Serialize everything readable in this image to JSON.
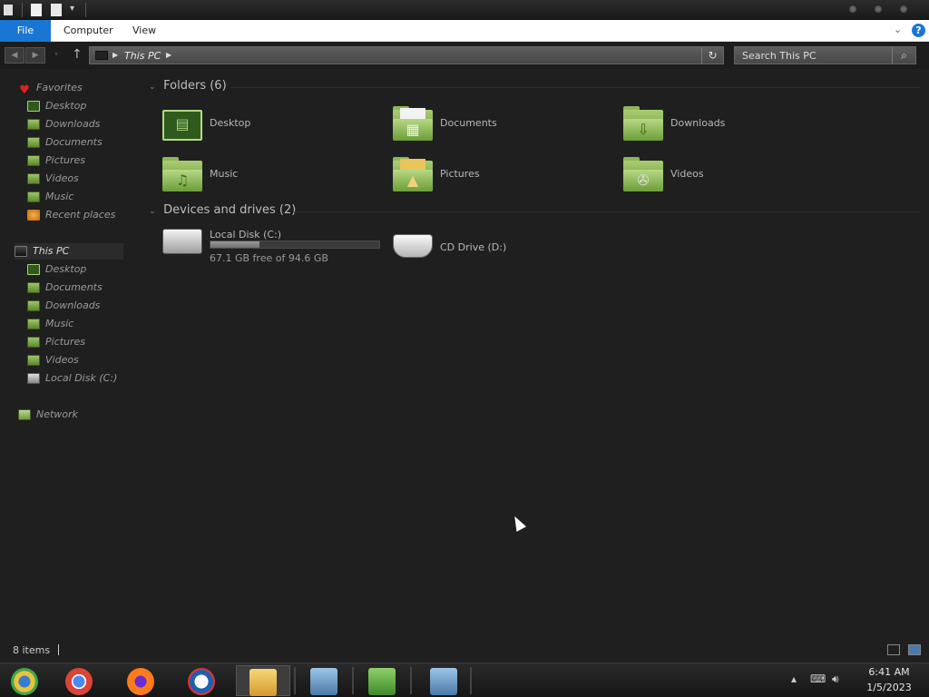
{
  "window": {
    "ribbon_tabs": [
      "File",
      "Computer",
      "View"
    ],
    "address": "This PC",
    "search_placeholder": "Search This PC"
  },
  "nav": {
    "favorites_label": "Favorites",
    "favorites": [
      "Desktop",
      "Downloads",
      "Documents",
      "Pictures",
      "Videos",
      "Music",
      "Recent places"
    ],
    "thispc_label": "This PC",
    "thispc": [
      "Desktop",
      "Documents",
      "Downloads",
      "Music",
      "Pictures",
      "Videos",
      "Local Disk (C:)"
    ],
    "network_label": "Network"
  },
  "content": {
    "folders_header": "Folders (6)",
    "folders": [
      "Desktop",
      "Documents",
      "Downloads",
      "Music",
      "Pictures",
      "Videos"
    ],
    "devices_header": "Devices and drives (2)",
    "drive_c": {
      "name": "Local Disk (C:)",
      "free_text": "67.1 GB free of 94.6 GB",
      "used_fraction": 0.29
    },
    "drive_d": {
      "name": "CD Drive (D:)"
    }
  },
  "status": {
    "items": "8 items"
  },
  "taskbar": {
    "apps": [
      "chrome-canary-icon",
      "chrome-icon",
      "firefox-icon",
      "obama-logo-icon",
      "file-explorer-icon",
      "setup-icon",
      "users-icon",
      "setup-icon"
    ],
    "time": "6:41 AM",
    "date": "1/5/2023"
  }
}
